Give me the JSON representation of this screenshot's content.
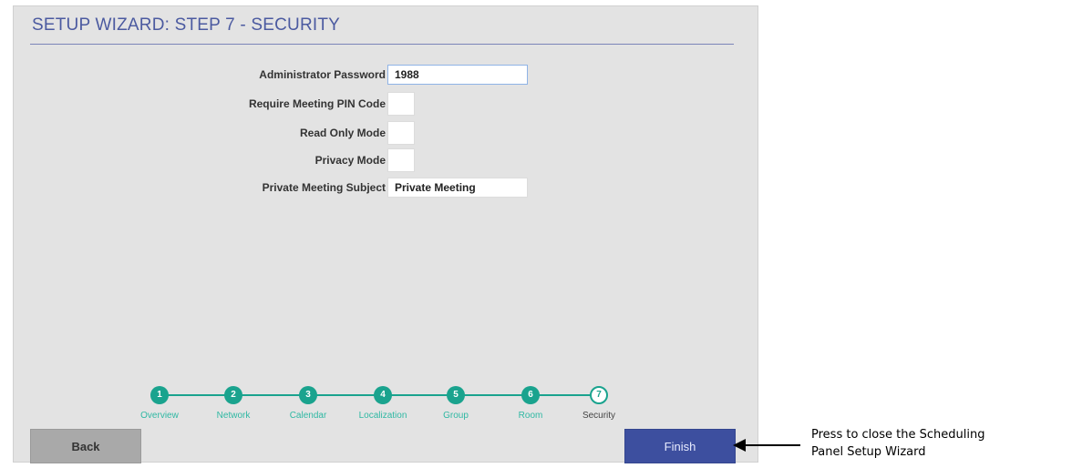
{
  "header": {
    "title": "SETUP WIZARD: STEP 7 - SECURITY"
  },
  "form": {
    "admin_password_label": "Administrator Password",
    "admin_password_value": "1988",
    "require_pin_label": "Require Meeting PIN Code",
    "read_only_label": "Read Only Mode",
    "privacy_label": "Privacy Mode",
    "private_subject_label": "Private Meeting Subject",
    "private_subject_value": "Private Meeting"
  },
  "steps": [
    {
      "number": "1",
      "label": "Overview"
    },
    {
      "number": "2",
      "label": "Network"
    },
    {
      "number": "3",
      "label": "Calendar"
    },
    {
      "number": "4",
      "label": "Localization"
    },
    {
      "number": "5",
      "label": "Group"
    },
    {
      "number": "6",
      "label": "Room"
    },
    {
      "number": "7",
      "label": "Security"
    }
  ],
  "buttons": {
    "back_label": "Back",
    "finish_label": "Finish"
  },
  "callout": {
    "line1": "Press to close the Scheduling",
    "line2": "Panel Setup Wizard"
  },
  "colors": {
    "accent": "#1aa38e",
    "title": "#4b5aa0",
    "finish": "#3d4f9f",
    "back": "#a9a9a9"
  }
}
